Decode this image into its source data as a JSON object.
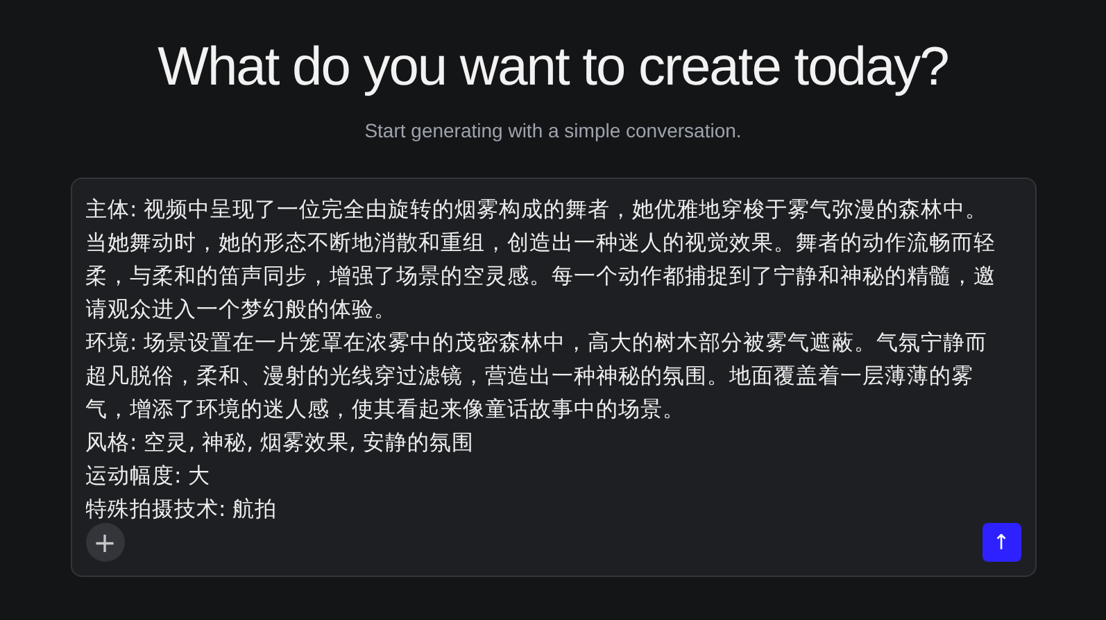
{
  "heading": "What do you want to create today?",
  "subheading": "Start generating with a simple conversation.",
  "prompt": {
    "paragraphs": [
      "主体: 视频中呈现了一位完全由旋转的烟雾构成的舞者，她优雅地穿梭于雾气弥漫的森林中。当她舞动时，她的形态不断地消散和重组，创造出一种迷人的视觉效果。舞者的动作流畅而轻柔，与柔和的笛声同步，增强了场景的空灵感。每一个动作都捕捉到了宁静和神秘的精髓，邀请观众进入一个梦幻般的体验。",
      "环境: 场景设置在一片笼罩在浓雾中的茂密森林中，高大的树木部分被雾气遮蔽。气氛宁静而超凡脱俗，柔和、漫射的光线穿过滤镜，营造出一种神秘的氛围。地面覆盖着一层薄薄的雾气，增添了环境的迷人感，使其看起来像童话故事中的场景。",
      "风格: 空灵, 神秘, 烟雾效果, 安静的氛围",
      "运动幅度: 大",
      "特殊拍摄技术: 航拍"
    ]
  },
  "add_button": "+",
  "send_button": "↑"
}
